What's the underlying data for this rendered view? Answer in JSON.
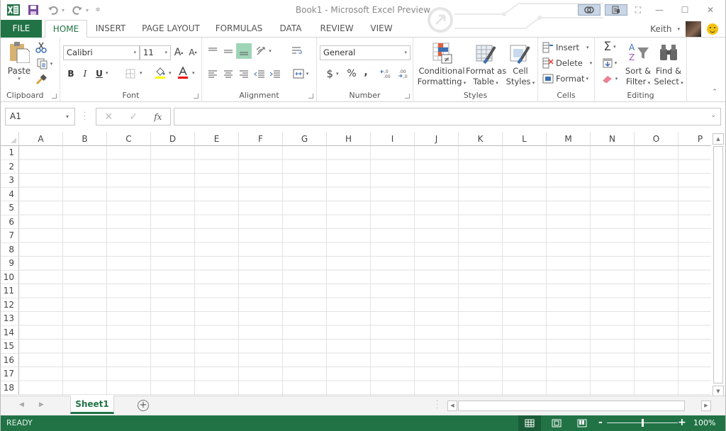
{
  "window": {
    "title": "Book1 - Microsoft Excel Preview",
    "qat": [
      {
        "icon": "excel-logo-icon"
      },
      {
        "icon": "save-icon"
      },
      {
        "icon": "undo-icon"
      },
      {
        "icon": "redo-icon"
      },
      {
        "icon": "customize-qat-icon"
      }
    ]
  },
  "tabs": [
    {
      "label": "FILE"
    },
    {
      "label": "HOME",
      "active": true
    },
    {
      "label": "INSERT"
    },
    {
      "label": "PAGE LAYOUT"
    },
    {
      "label": "FORMULAS"
    },
    {
      "label": "DATA"
    },
    {
      "label": "REVIEW"
    },
    {
      "label": "VIEW"
    }
  ],
  "user": {
    "name": "Keith"
  },
  "ribbon": {
    "clipboard": {
      "label": "Clipboard",
      "paste": "Paste"
    },
    "font": {
      "label": "Font",
      "font_name": "Calibri",
      "font_size": "11",
      "bold": "B",
      "italic": "I",
      "underline": "U"
    },
    "alignment": {
      "label": "Alignment"
    },
    "number": {
      "label": "Number",
      "format": "General",
      "currency": "$",
      "percent": "%",
      "comma": ","
    },
    "styles": {
      "label": "Styles",
      "conditional_1": "Conditional",
      "conditional_2": "Formatting",
      "format_table_1": "Format as",
      "format_table_2": "Table",
      "cell_styles_1": "Cell",
      "cell_styles_2": "Styles"
    },
    "cells": {
      "label": "Cells",
      "insert": "Insert",
      "delete": "Delete",
      "format": "Format"
    },
    "editing": {
      "label": "Editing",
      "sort_1": "Sort &",
      "sort_2": "Filter",
      "find_1": "Find &",
      "find_2": "Select"
    }
  },
  "formula_bar": {
    "name_box": "A1",
    "formula": "",
    "fx": "fx"
  },
  "grid": {
    "columns": [
      "A",
      "B",
      "C",
      "D",
      "E",
      "F",
      "G",
      "H",
      "I",
      "J",
      "K",
      "L",
      "M",
      "N",
      "O",
      "P"
    ],
    "rows": [
      "1",
      "2",
      "3",
      "4",
      "5",
      "6",
      "7",
      "8",
      "9",
      "10",
      "11",
      "12",
      "13",
      "14",
      "15",
      "16",
      "17",
      "18"
    ]
  },
  "sheets": [
    {
      "label": "Sheet1",
      "active": true
    }
  ],
  "status": {
    "mode": "READY",
    "zoom": "100%",
    "zoom_level_percent": 100
  },
  "colors": {
    "accent": "#217346",
    "status_bar": "#217346"
  }
}
